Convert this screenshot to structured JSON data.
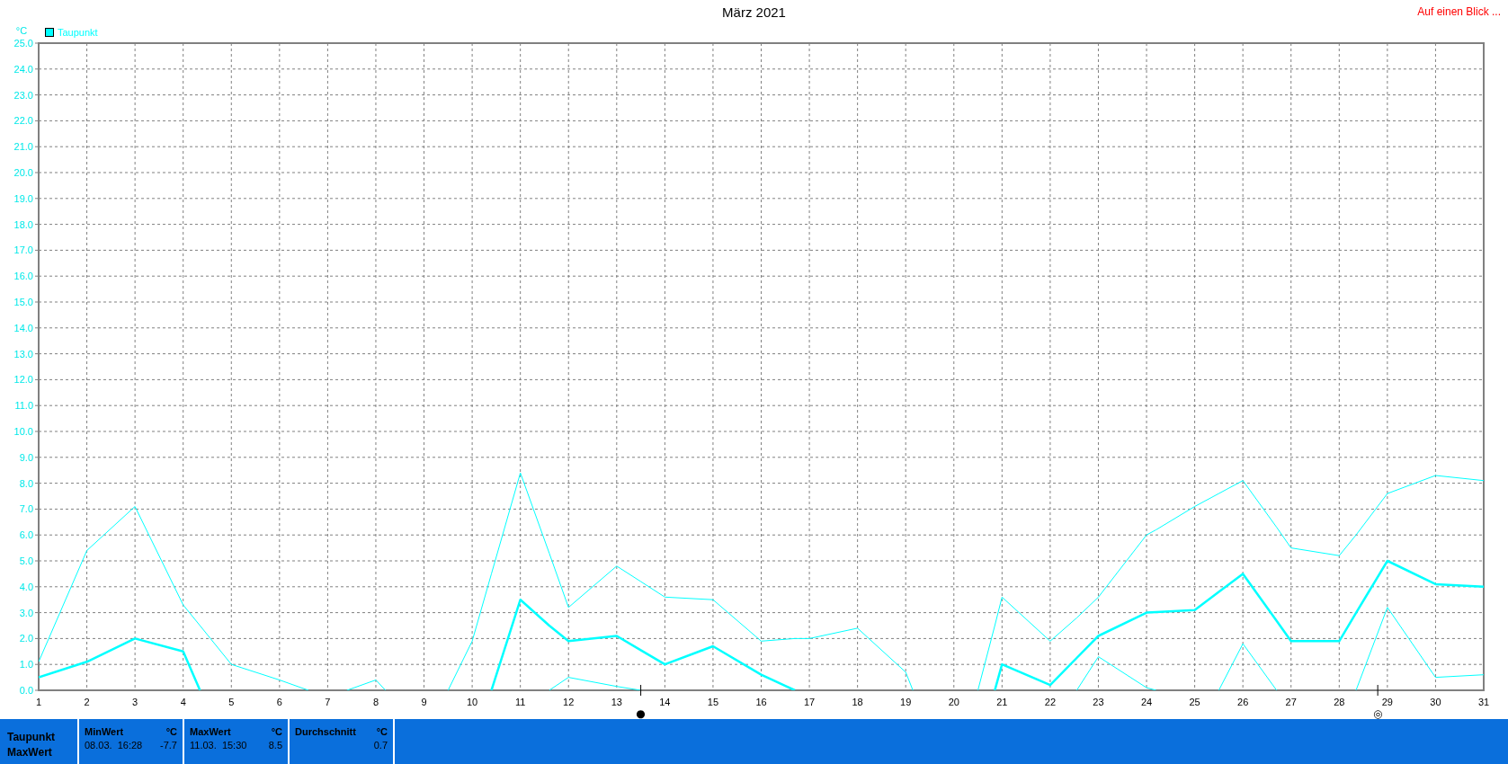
{
  "header": {
    "link": "Auf einen Blick ..."
  },
  "chart": {
    "legend_label": "Taupunkt",
    "chart_data": {
      "type": "line",
      "title": "März 2021",
      "ylabel": "°C",
      "grid": true,
      "x": [
        1,
        2,
        3,
        4,
        4.35,
        5,
        6,
        6.6,
        7,
        7.4,
        8,
        8.2,
        9,
        9.5,
        10,
        10.4,
        11,
        11.6,
        12,
        13,
        13.5,
        14,
        15,
        16,
        16.7,
        17,
        18,
        19,
        19.15,
        20,
        20.5,
        20.85,
        21,
        22,
        22.55,
        23,
        24,
        24.2,
        25,
        25.5,
        26,
        26.7,
        27,
        28,
        28.35,
        29,
        30,
        31
      ],
      "series": [
        {
          "color": "#00ffff",
          "values": [
            1.1,
            5.4,
            7.1,
            3.3,
            2.5,
            1.0,
            0.4,
            0,
            null,
            0,
            0.4,
            0,
            null,
            0,
            1.9,
            4.5,
            8.4,
            5.3,
            3.2,
            4.8,
            4.2,
            3.6,
            3.5,
            1.9,
            2.0,
            2.0,
            2.4,
            0.7,
            0,
            null,
            0,
            2.5,
            3.6,
            1.9,
            2.8,
            3.6,
            6.0,
            6.2,
            7.1,
            7.6,
            8.1,
            6.3,
            5.5,
            5.2,
            6.0,
            7.6,
            8.3,
            8.1
          ]
        },
        {
          "color": "#00ffff",
          "values": [
            0.5,
            1.1,
            2.0,
            1.5,
            0,
            null,
            null,
            null,
            null,
            null,
            null,
            null,
            null,
            null,
            null,
            0,
            3.5,
            2.5,
            1.9,
            2.1,
            1.55,
            1.0,
            1.7,
            0.6,
            0,
            null,
            null,
            null,
            null,
            null,
            null,
            0,
            1.0,
            0.2,
            1.25,
            2.1,
            3.0,
            3.02,
            3.1,
            3.8,
            4.5,
            2.68,
            1.9,
            1.9,
            2.99,
            5.0,
            4.1,
            4.0
          ]
        },
        {
          "color": "#00ffff",
          "values": [
            null,
            null,
            null,
            null,
            null,
            null,
            null,
            null,
            null,
            null,
            null,
            null,
            null,
            null,
            null,
            null,
            null,
            0,
            0.5,
            0.15,
            0,
            null,
            null,
            null,
            null,
            null,
            null,
            null,
            null,
            null,
            null,
            null,
            null,
            null,
            0,
            1.3,
            0.1,
            0,
            null,
            0,
            1.8,
            0,
            null,
            null,
            0,
            3.2,
            0.5,
            0.6
          ]
        }
      ],
      "xlim": [
        1,
        31
      ],
      "ylim": [
        0,
        25
      ],
      "xticks": [
        1,
        2,
        3,
        4,
        5,
        6,
        7,
        8,
        9,
        10,
        11,
        12,
        13,
        14,
        15,
        16,
        17,
        18,
        19,
        20,
        21,
        22,
        23,
        24,
        25,
        26,
        27,
        28,
        29,
        30,
        31
      ],
      "yticks": [
        {
          "value": 0,
          "label": "0.0"
        },
        {
          "value": 1,
          "label": "1.0"
        },
        {
          "value": 2,
          "label": "2.0"
        },
        {
          "value": 3,
          "label": "3.0"
        },
        {
          "value": 4,
          "label": "4.0"
        },
        {
          "value": 5,
          "label": "5.0"
        },
        {
          "value": 6,
          "label": "6.0"
        },
        {
          "value": 7,
          "label": "7.0"
        },
        {
          "value": 8,
          "label": "8.0"
        },
        {
          "value": 9,
          "label": "9.0"
        },
        {
          "value": 10,
          "label": "10.0"
        },
        {
          "value": 11,
          "label": "11.0"
        },
        {
          "value": 12,
          "label": "12.0"
        },
        {
          "value": 13,
          "label": "13.0"
        },
        {
          "value": 14,
          "label": "14.0"
        },
        {
          "value": 15,
          "label": "15.0"
        },
        {
          "value": 16,
          "label": "16.0"
        },
        {
          "value": 17,
          "label": "17.0"
        },
        {
          "value": 18,
          "label": "18.0"
        },
        {
          "value": 19,
          "label": "19.0"
        },
        {
          "value": 20,
          "label": "20.0"
        },
        {
          "value": 21,
          "label": "21.0"
        },
        {
          "value": 22,
          "label": "22.0"
        },
        {
          "value": 23,
          "label": "23.0"
        },
        {
          "value": 24,
          "label": "24.0"
        },
        {
          "value": 25,
          "label": "25.0"
        }
      ],
      "annotations": [
        "●",
        "◎"
      ]
    }
  },
  "stats": {
    "row_labels": [
      "Taupunkt",
      "MaxWert"
    ],
    "columns": [
      {
        "title": "MinWert",
        "unit": "°C",
        "time": "08.03.  16:28",
        "value": "-7.7"
      },
      {
        "title": "MaxWert",
        "unit": "°C",
        "time": "11.03.  15:30",
        "value": "8.5"
      },
      {
        "title": "Durchschnitt",
        "unit": "°C",
        "value": "0.7"
      }
    ]
  }
}
